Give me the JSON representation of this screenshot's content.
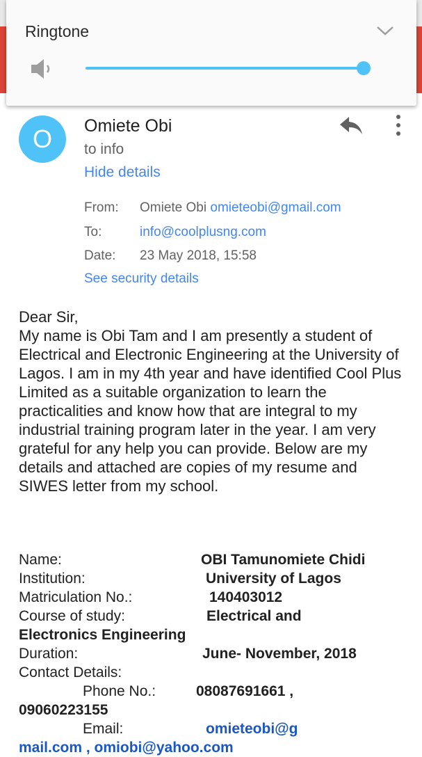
{
  "volume": {
    "title": "Ringtone",
    "level": 1.0,
    "accent": "#4fc3f7"
  },
  "email": {
    "avatar_letter": "O",
    "sender": "Omiete Obi",
    "to_line": "to info",
    "hide_details": "Hide details",
    "meta": {
      "from_label": "From:",
      "from_name": "Omiete Obi",
      "from_email": "omieteobi@gmail.com",
      "to_label": "To:",
      "to_email": "info@coolplusng.com",
      "date_label": "Date:",
      "date_value": "23 May 2018, 15:58"
    },
    "security_details": "See security details",
    "greeting": "Dear Sir,",
    "body": "My name is Obi Tam and I am presently a student of Electrical and Electronic Engineering at the University of Lagos. I am in my 4th year and have identified Cool Plus Limited as a suitable organization to learn the practicalities and know how that are integral to my industrial training program later in the year. I am very grateful for any help you can provide. Below are my details and attached are copies of my resume and SIWES letter from my school.",
    "details": {
      "name_label": "Name:",
      "name_value": "OBI Tamunomiete Chidi",
      "institution_label": "Institution:",
      "institution_value": "University of Lagos",
      "matric_label": "Matriculation No.:",
      "matric_value": "140403012",
      "course_label": "Course of study:",
      "course_value_1": "Electrical and",
      "course_value_2": "Electronics Engineering",
      "duration_label": "Duration:",
      "duration_value": "June- November, 2018",
      "contact_label": "Contact Details:",
      "phone_label": "Phone No.:",
      "phone_value_1": "08087691661 ,",
      "phone_value_2": "09060223155",
      "email_label": "Email:",
      "email_value_1": "omieteobi@g",
      "email_value_2": "mail.com , omiobi@yahoo.com"
    }
  }
}
